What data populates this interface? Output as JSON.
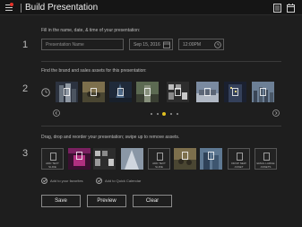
{
  "header": {
    "title": "Build Presentation",
    "menu_icon": "hamburger-menu-icon",
    "right_icons": [
      "document-icon",
      "calendar-icon"
    ],
    "notification_color": "#e5332a"
  },
  "step1": {
    "number": "1",
    "instruction": "Fill in the name, date, & time of your presentation:",
    "name_placeholder": "Presentation Name",
    "date_value": "Sep 15, 2016",
    "time_value": "12:00PM"
  },
  "step2": {
    "number": "2",
    "instruction": "Find the brand and sales assets for this presentation:",
    "thumbnails": [
      "city-tower",
      "cyclists",
      "skyscraper",
      "corridor",
      "aerial-city",
      "glass-facade",
      "building",
      "skyline",
      "night-city"
    ],
    "pagination_count": 6,
    "active_page": 2,
    "accent_color": "#e0c020"
  },
  "step3": {
    "number": "3",
    "instruction": "Drag, drop and reorder your presentation; swipe up to remove assets.",
    "assets": [
      {
        "type": "placeholder",
        "label": "ADD TEXT SLIDE"
      },
      {
        "type": "image",
        "label": ""
      },
      {
        "type": "image",
        "label": ""
      },
      {
        "type": "image",
        "label": ""
      },
      {
        "type": "placeholder",
        "label": "ADD TEXT SLIDE"
      },
      {
        "type": "image",
        "label": ""
      },
      {
        "type": "image",
        "label": ""
      },
      {
        "type": "placeholder",
        "label": "DROP NEW ASSET"
      },
      {
        "type": "placeholder",
        "label": "EMAIL LARGE ASSETS"
      }
    ],
    "favorites_label": "Add to your favorites",
    "calendar_label": "Add to Quick Calendar"
  },
  "buttons": {
    "save": "Save",
    "preview": "Preview",
    "clear": "Clear"
  }
}
